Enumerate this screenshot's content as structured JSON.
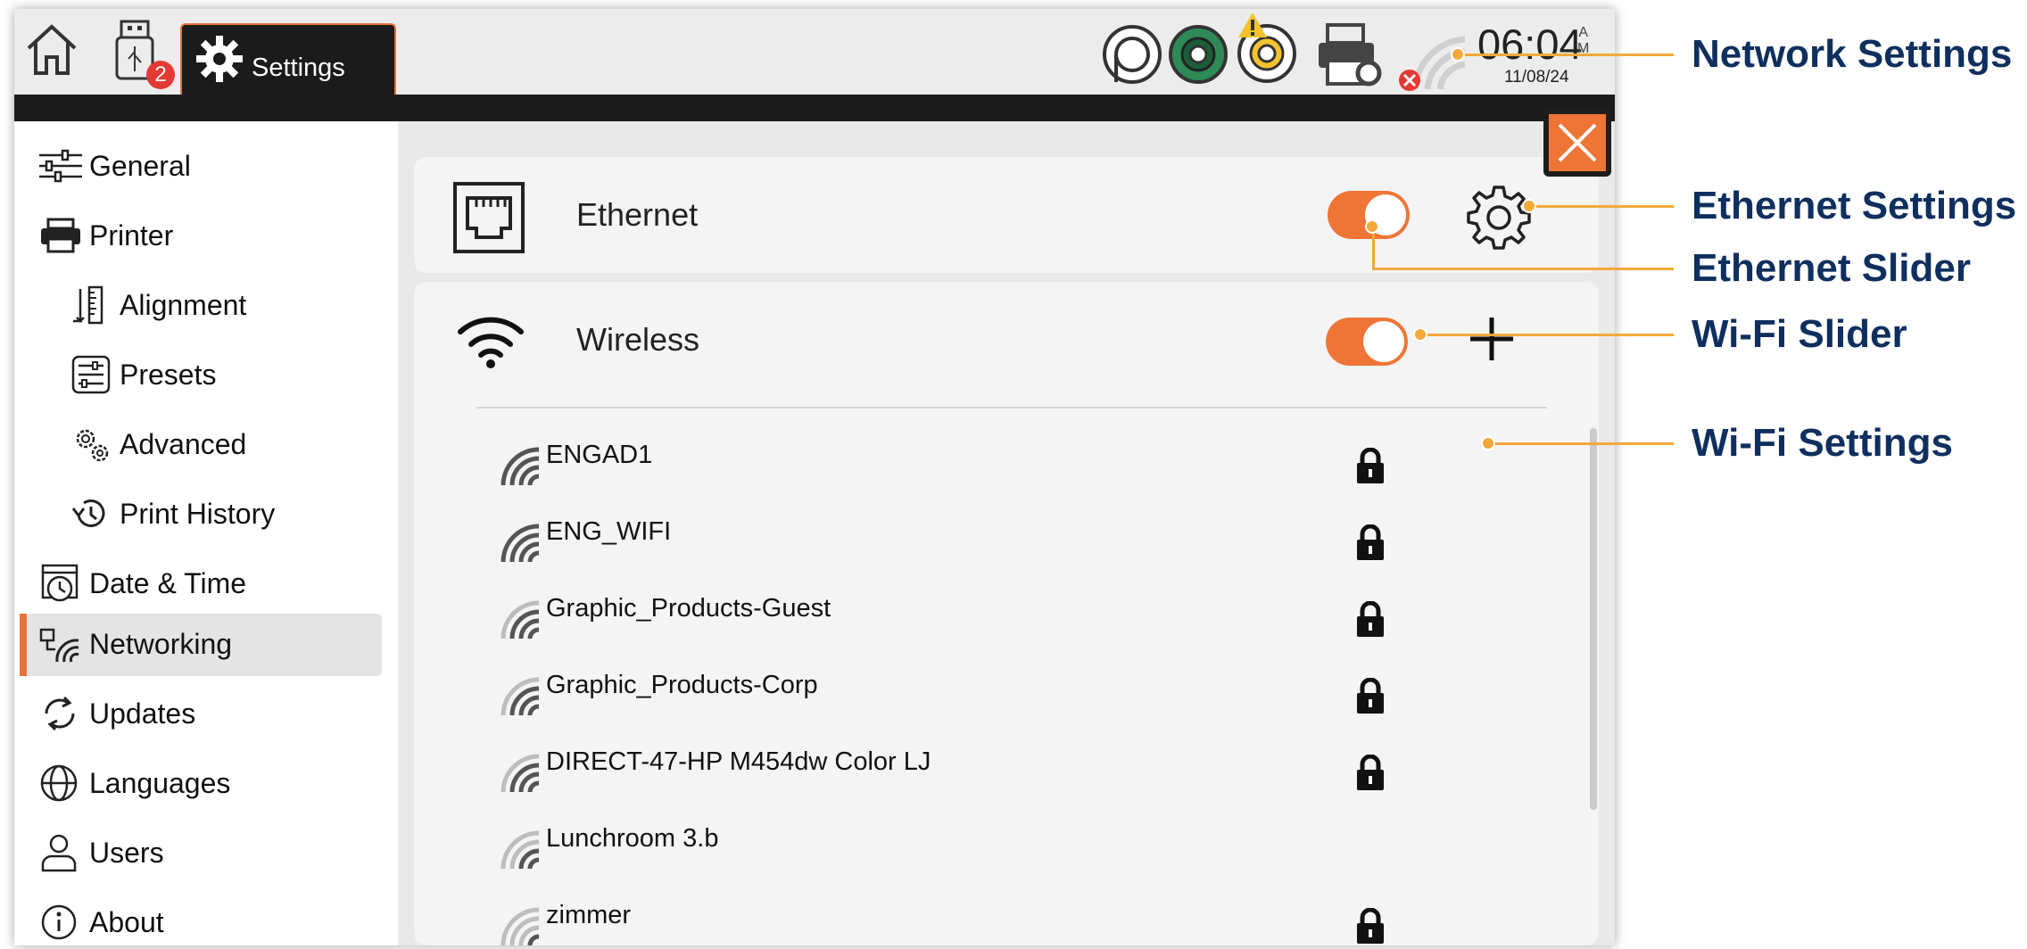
{
  "topbar": {
    "tab_label": "Settings",
    "usb_badge": "2",
    "time": "06:04",
    "ampm_a": "A",
    "ampm_m": "M",
    "date": "11/08/24",
    "icons": [
      "home-icon",
      "usb-icon",
      "gear-icon",
      "print-head-icon",
      "green-ribbon-icon",
      "warning-ribbon-icon",
      "printer-settings-icon",
      "wifi-error-icon"
    ]
  },
  "sidebar": {
    "items": [
      {
        "label": "General",
        "icon": "sliders-icon"
      },
      {
        "label": "Printer",
        "icon": "printer-icon"
      },
      {
        "label": "Alignment",
        "icon": "ruler-icon"
      },
      {
        "label": "Presets",
        "icon": "presets-icon"
      },
      {
        "label": "Advanced",
        "icon": "gears-icon"
      },
      {
        "label": "Print History",
        "icon": "history-icon"
      },
      {
        "label": "Date & Time",
        "icon": "clock-icon"
      },
      {
        "label": "Networking",
        "icon": "network-icon",
        "active": true
      },
      {
        "label": "Updates",
        "icon": "refresh-icon"
      },
      {
        "label": "Languages",
        "icon": "globe-icon"
      },
      {
        "label": "Users",
        "icon": "user-icon"
      },
      {
        "label": "About",
        "icon": "info-icon"
      }
    ]
  },
  "ethernet": {
    "label": "Ethernet",
    "enabled": true
  },
  "wireless": {
    "label": "Wireless",
    "enabled": true,
    "networks": [
      {
        "name": "ENGAD1",
        "locked": true,
        "strength": "strong"
      },
      {
        "name": "ENG_WIFI",
        "locked": true,
        "strength": "strong"
      },
      {
        "name": "Graphic_Products-Guest",
        "locked": true,
        "strength": "medium"
      },
      {
        "name": "Graphic_Products-Corp",
        "locked": true,
        "strength": "medium"
      },
      {
        "name": "DIRECT-47-HP M454dw Color LJ",
        "locked": true,
        "strength": "medium"
      },
      {
        "name": "Lunchroom 3.b",
        "locked": false,
        "strength": "weak"
      },
      {
        "name": "zimmer",
        "locked": true,
        "strength": "weak"
      }
    ]
  },
  "annotations": {
    "network_settings": "Network Settings",
    "ethernet_settings": "Ethernet Settings",
    "ethernet_slider": "Ethernet Slider",
    "wifi_slider": "Wi-Fi Slider",
    "wifi_settings": "Wi-Fi Settings"
  },
  "colors": {
    "accent": "#ef7536",
    "annotation": "#f4a93a",
    "annotation_text": "#0f2f5e"
  }
}
